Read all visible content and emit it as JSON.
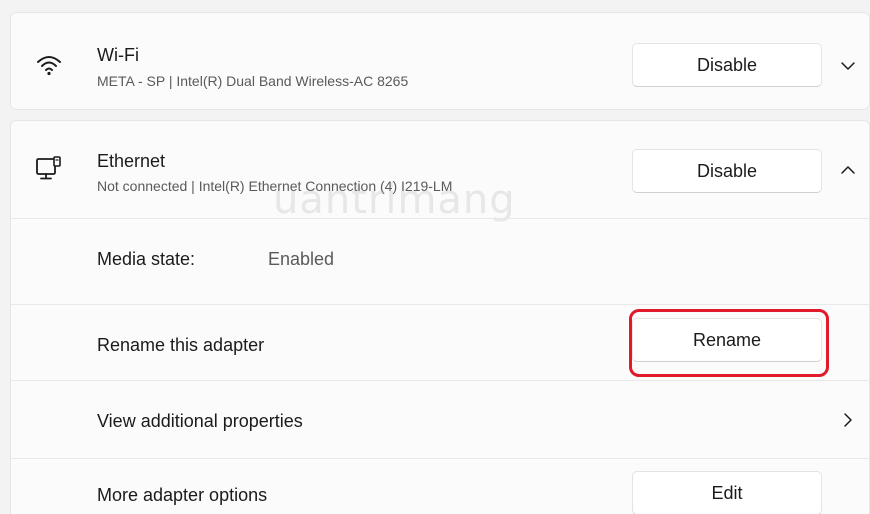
{
  "wifi": {
    "icon": "wifi-icon",
    "title": "Wi-Fi",
    "subtitle": "META - SP | Intel(R) Dual Band Wireless-AC 8265",
    "button_label": "Disable",
    "chevron": "chevron-down-icon"
  },
  "ethernet": {
    "icon": "ethernet-icon",
    "title": "Ethernet",
    "subtitle": "Not connected | Intel(R) Ethernet Connection (4) I219-LM",
    "button_label": "Disable",
    "chevron": "chevron-up-icon",
    "watermark": "uantrimang",
    "rows": {
      "media_state": {
        "label": "Media state:",
        "value": "Enabled"
      },
      "rename": {
        "label": "Rename this adapter",
        "button_label": "Rename",
        "highlight_color": "#e0192b"
      },
      "properties": {
        "label": "View additional properties",
        "chevron": "chevron-right-icon"
      },
      "more_options": {
        "label": "More adapter options",
        "button_label": "Edit"
      }
    }
  }
}
